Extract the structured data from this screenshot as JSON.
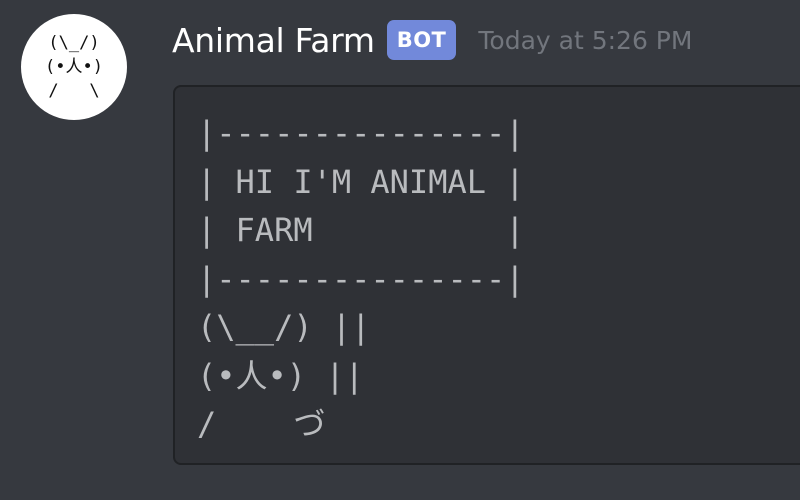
{
  "message": {
    "author": {
      "name": "Animal Farm",
      "tag": "BOT",
      "avatar_art": "(\\_/)\n(•人•)\n/   \\"
    },
    "timestamp": "Today at 5:26 PM",
    "code_block": "|---------------|\n| HI I'M ANIMAL |\n| FARM          |\n|---------------|\n(\\__/) ||\n(•人•) ||\n/    づ"
  },
  "colors": {
    "background": "#36393f",
    "code_background": "#2f3136",
    "bot_tag": "#7289da",
    "timestamp": "#72767d",
    "username": "#ffffff"
  },
  "icons": {
    "avatar": "rabbit-ascii-avatar"
  }
}
